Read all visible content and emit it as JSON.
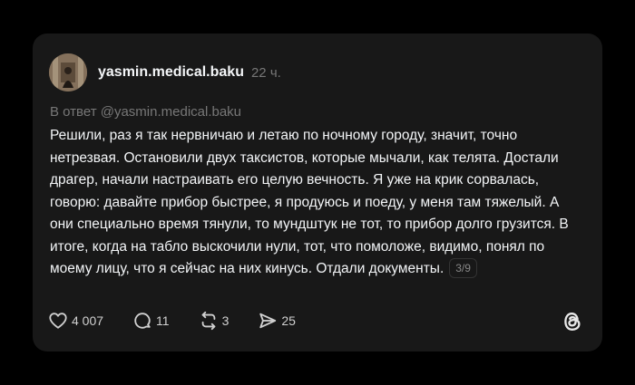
{
  "post": {
    "username": "yasmin.medical.baku",
    "timestamp": "22 ч.",
    "reply_to": "В ответ @yasmin.medical.baku",
    "body": "Решили, раз я так нервничаю и летаю по ночному городу, значит, точно нетрезвая. Остановили двух таксистов, которые мычали, как телята. Достали драгер, начали настраивать его целую вечность. Я уже на крик сорвалась, говорю: давайте прибор быстрее, я продуюсь и поеду, у меня там тяжелый. А они специально время тянули, то мундштук не тот, то прибор долго грузится. В итоге, когда на табло выскочили нули, тот, что помоложе, видимо, понял по моему лицу, что я сейчас на них кинусь. Отдали документы.",
    "page_counter": "3/9"
  },
  "actions": {
    "likes": "4 007",
    "comments": "11",
    "reposts": "3",
    "shares": "25"
  },
  "icons": {
    "like": "heart-icon",
    "comment": "comment-bubble-icon",
    "repost": "repost-icon",
    "share": "send-icon",
    "brand": "threads-logo-icon"
  },
  "colors": {
    "background": "#000000",
    "card": "#181818",
    "text": "#f3f5f7",
    "muted": "#777777"
  }
}
